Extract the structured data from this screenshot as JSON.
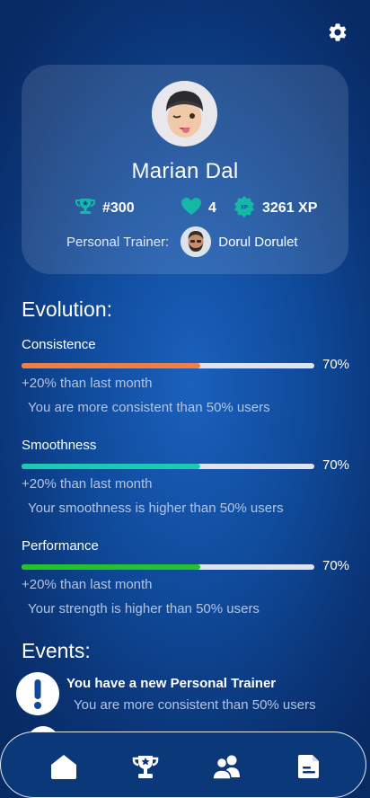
{
  "profile": {
    "name": "Marian Dal",
    "rank": "#300",
    "hearts": "4",
    "xp_value": "3261 XP",
    "trainer_label": "Personal Trainer:",
    "trainer_name": "Dorul Dorulet",
    "icons": {
      "rank": "trophy-icon",
      "hearts": "heart-icon",
      "xp": "xp-badge-icon"
    }
  },
  "evolution": {
    "title": "Evolution:",
    "metrics": [
      {
        "label": "Consistence",
        "percent": 70,
        "percent_text": "70%",
        "progress": 0.61,
        "color": "#f07f45",
        "delta": "+20% than last month",
        "compare": "You are more consistent than 50% users"
      },
      {
        "label": "Smoothness",
        "percent": 70,
        "percent_text": "70%",
        "progress": 0.61,
        "color": "#1ccab3",
        "delta": "+20% than last month",
        "compare": "Your smoothness is higher than 50% users"
      },
      {
        "label": "Performance",
        "percent": 70,
        "percent_text": "70%",
        "progress": 0.61,
        "color": "#24c22c",
        "delta": "+20% than last month",
        "compare": "Your strength is higher than 50% users"
      }
    ]
  },
  "events": {
    "title": "Events:",
    "items": [
      {
        "title": "You have a new Personal Trainer",
        "subtitle": "You are more consistent than 50% users",
        "icon": "alert-icon"
      }
    ]
  },
  "nav": {
    "items": [
      {
        "name": "home",
        "icon": "home-icon",
        "active": true
      },
      {
        "name": "leaderboard",
        "icon": "trophy-icon"
      },
      {
        "name": "friends",
        "icon": "users-icon"
      },
      {
        "name": "documents",
        "icon": "document-icon"
      }
    ]
  },
  "colors": {
    "background": "#0f4a9a",
    "card": "rgba(255,255,255,0.13)",
    "track": "#dfe3ee",
    "badge": "#14b8a6"
  }
}
